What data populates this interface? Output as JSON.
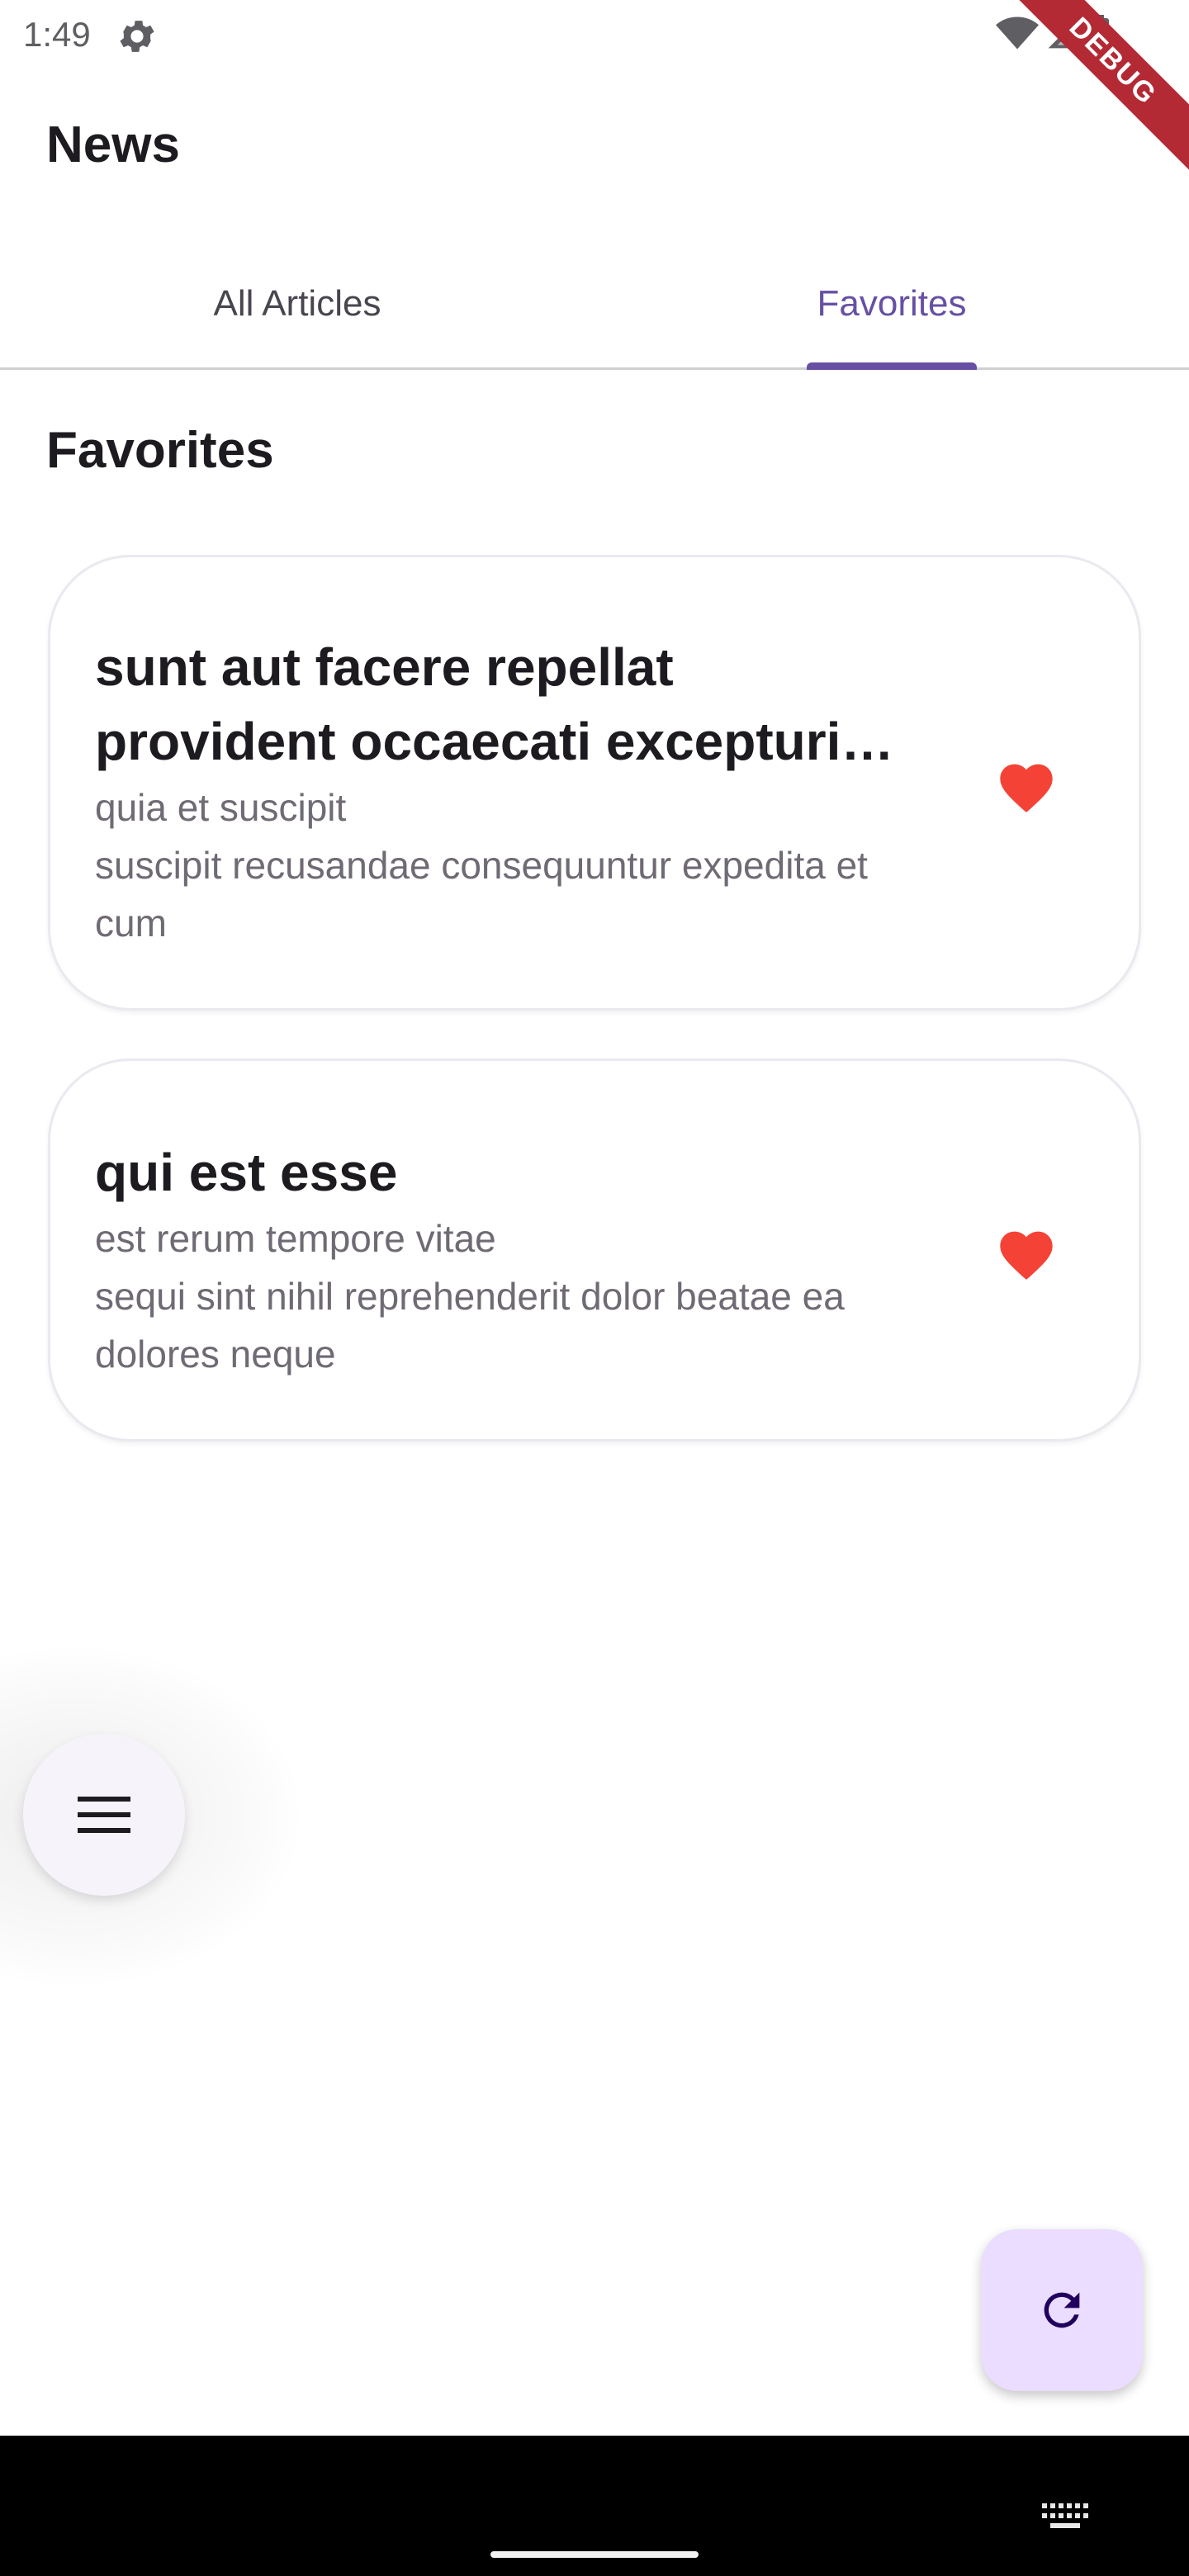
{
  "status_bar": {
    "time": "1:49",
    "icons": [
      "settings-icon",
      "wifi-icon",
      "signal-icon",
      "battery-icon"
    ],
    "debug_banner": "DEBUG"
  },
  "app_bar": {
    "title": "News"
  },
  "tabs": [
    {
      "label": "All Articles",
      "selected": false
    },
    {
      "label": "Favorites",
      "selected": true
    }
  ],
  "section": {
    "title": "Favorites"
  },
  "articles": [
    {
      "title": "sunt aut facere repellat provident occaecati excepturi optio reprehenderit",
      "body": "quia et suscipit\nsuscipit recusandae consequuntur expedita et cum",
      "favorite": true,
      "icon": "heart-icon"
    },
    {
      "title": "qui est esse",
      "body": "est rerum tempore vitae\nsequi sint nihil reprehenderit dolor beatae ea dolores neque",
      "favorite": true,
      "icon": "heart-icon"
    }
  ],
  "fab": {
    "menu_icon": "menu-icon",
    "refresh_icon": "refresh-icon"
  },
  "colors": {
    "accent": "#6750a4",
    "heart": "#f44336",
    "fab_background": "#eaddff",
    "debug_ribbon": "#b32a35"
  }
}
